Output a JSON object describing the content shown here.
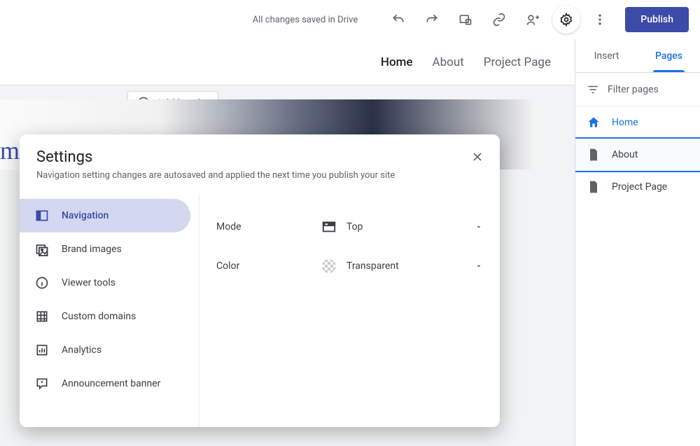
{
  "topbar": {
    "save_status": "All changes saved in Drive",
    "publish_label": "Publish"
  },
  "site_nav": {
    "items": [
      {
        "label": "Home",
        "active": true
      },
      {
        "label": "About",
        "active": false
      },
      {
        "label": "Project Page",
        "active": false
      }
    ]
  },
  "add_header_label": "Add header",
  "hero_title_fragment": "mel a",
  "right_panel": {
    "tabs": [
      {
        "label": "Insert",
        "active": false
      },
      {
        "label": "Pages",
        "active": true
      }
    ],
    "filter_label": "Filter pages",
    "pages": [
      {
        "label": "Home"
      },
      {
        "label": "About"
      },
      {
        "label": "Project Page"
      }
    ]
  },
  "settings_modal": {
    "title": "Settings",
    "subtitle": "Navigation setting changes are autosaved and applied the next time you publish your site",
    "sidebar": [
      {
        "label": "Navigation"
      },
      {
        "label": "Brand images"
      },
      {
        "label": "Viewer tools"
      },
      {
        "label": "Custom domains"
      },
      {
        "label": "Analytics"
      },
      {
        "label": "Announcement banner"
      }
    ],
    "content": {
      "mode_label": "Mode",
      "mode_value": "Top",
      "color_label": "Color",
      "color_value": "Transparent"
    }
  }
}
